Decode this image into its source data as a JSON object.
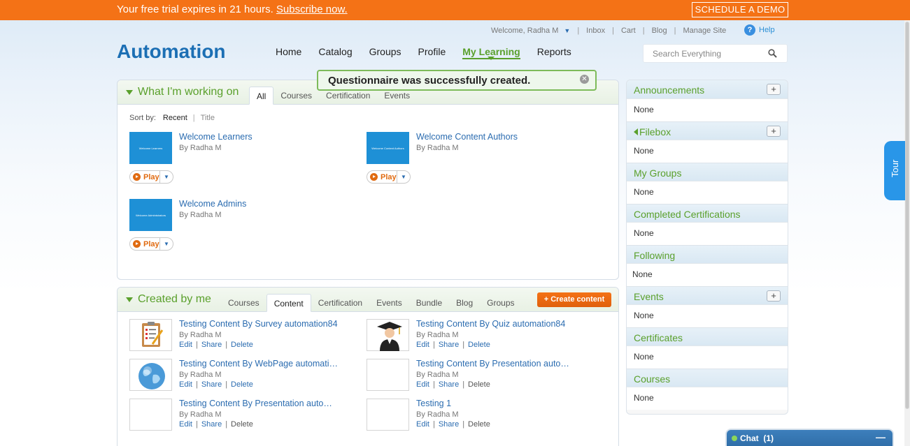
{
  "trial_banner": {
    "message": "Your free trial expires in 21 hours.",
    "link": "Subscribe now.",
    "demo_button": "SCHEDULE A DEMO"
  },
  "utility_nav": {
    "welcome": "Welcome, Radha M",
    "links": [
      "Inbox",
      "Cart",
      "Blog",
      "Manage Site"
    ],
    "help": "Help"
  },
  "brand": {
    "logo": "Automation"
  },
  "main_nav": {
    "items": [
      "Home",
      "Catalog",
      "Groups",
      "Profile",
      "My Learning",
      "Reports"
    ],
    "active": "My Learning"
  },
  "search": {
    "placeholder": "Search Everything"
  },
  "toast": {
    "message": "Questionnaire was successfully created."
  },
  "working_on": {
    "title": "What I'm working on",
    "tabs": [
      "All",
      "Courses",
      "Certification",
      "Events"
    ],
    "active_tab": "All",
    "sort_label": "Sort by:",
    "sort_options": [
      "Recent",
      "Title"
    ],
    "items": [
      {
        "title": "Welcome Learners",
        "by": "By Radha M",
        "thumb_text": "Welcome Learners",
        "play": "Play"
      },
      {
        "title": "Welcome Content Authors",
        "by": "By Radha M",
        "thumb_text": "Welcome Content Authors",
        "play": "Play"
      },
      {
        "title": "Welcome Admins",
        "by": "By Radha M",
        "thumb_text": "Welcome Administrators",
        "play": "Play"
      }
    ]
  },
  "created_by_me": {
    "title": "Created by me",
    "tabs": [
      "Courses",
      "Content",
      "Certification",
      "Events",
      "Bundle",
      "Blog",
      "Groups"
    ],
    "active_tab": "Content",
    "create_button": "+ Create content",
    "actions": {
      "edit": "Edit",
      "share": "Share",
      "delete": "Delete"
    },
    "items": [
      {
        "title": "Testing Content By Survey automation84",
        "by": "By Radha M",
        "icon": "survey-clipboard-icon"
      },
      {
        "title": "Testing Content By Quiz automation84",
        "by": "By Radha M",
        "icon": "graduate-icon"
      },
      {
        "title": "Testing Content By WebPage automati…",
        "by": "By Radha M",
        "icon": "globe-icon"
      },
      {
        "title": "Testing Content By Presentation auto…",
        "by": "By Radha M",
        "icon": "blank-thumbnail"
      },
      {
        "title": "Testing Content By Presentation auto…",
        "by": "By Radha M",
        "icon": "blank-thumbnail"
      },
      {
        "title": "Testing 1",
        "by": "By Radha M",
        "icon": "blank-thumbnail"
      }
    ]
  },
  "sidebar": {
    "sections": [
      {
        "title": "Announcements",
        "value": "None",
        "has_add": true
      },
      {
        "title": "Filebox",
        "value": "None",
        "has_add": true
      },
      {
        "title": "My Groups",
        "value": "None",
        "has_add": false
      },
      {
        "title": "Completed Certifications",
        "value": "None",
        "has_add": false
      },
      {
        "title": "Following",
        "value": "None",
        "has_add": false
      },
      {
        "title": "Events",
        "value": "None",
        "has_add": true
      },
      {
        "title": "Certificates",
        "value": "None",
        "has_add": false
      },
      {
        "title": "Courses",
        "value": "None",
        "has_add": false
      }
    ],
    "add_symbol": "+"
  },
  "tour": {
    "label": "Tour"
  },
  "chat": {
    "label": "Chat  (1)",
    "minimize": "—"
  },
  "colors": {
    "accent_orange": "#f47216",
    "brand_blue": "#1c6fb4",
    "green": "#5aa02c",
    "link_blue": "#2b6cb0"
  }
}
